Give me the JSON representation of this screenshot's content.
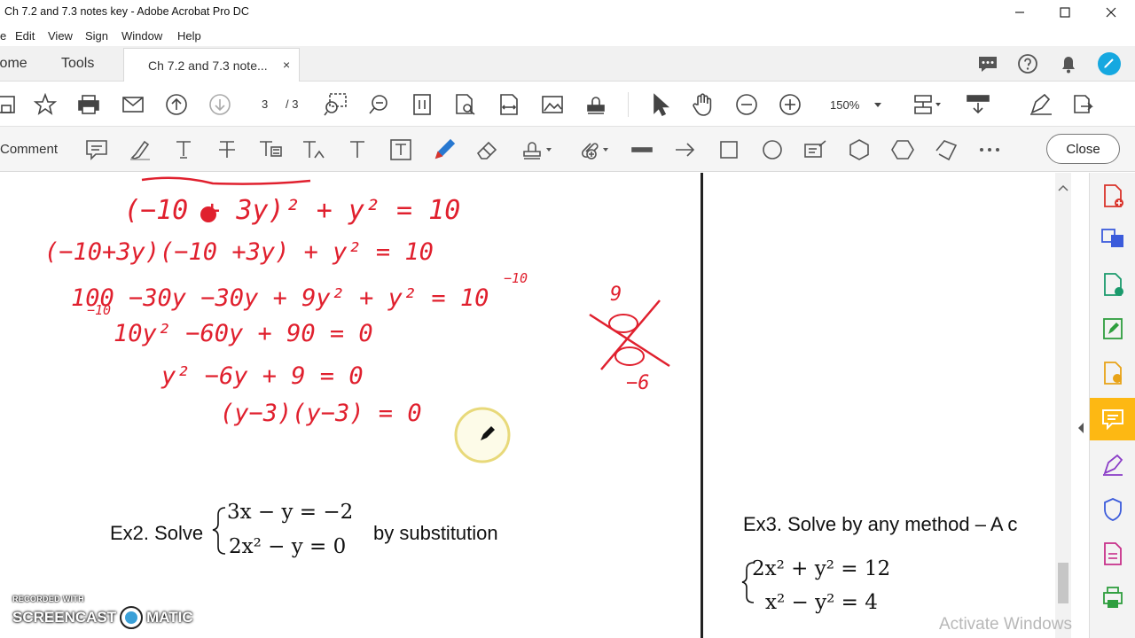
{
  "window": {
    "title": "Ch 7.2 and 7.3 notes key - Adobe Acrobat Pro DC"
  },
  "menu": {
    "items": [
      "e",
      "Edit",
      "View",
      "Sign",
      "Window",
      "Help"
    ]
  },
  "tabs": {
    "home": "Home",
    "tools": "Tools",
    "document": "Ch 7.2 and 7.3 note...",
    "close_glyph": "×"
  },
  "toolbar": {
    "current_page": "3",
    "total_pages": "/ 3",
    "zoom": "150%"
  },
  "comment_toolbar": {
    "label": "Comment",
    "close_label": "Close"
  },
  "document": {
    "handwriting": [
      "(−10 + 3y)² + y² = 10",
      "(−10+3y)(−10 +3y) + y² = 10",
      "100 −30y −30y + 9y² + y² = 10",
      "−10",
      "−10",
      "10y² −60y + 90 = 0",
      "y² −6y + 9 = 0",
      "(y−3)(y−3) = 0",
      "9",
      "−6"
    ],
    "ex2_label": "Ex2. Solve",
    "ex2_eq1": "3x − y = −2",
    "ex2_eq2": "2x² − y = 0",
    "ex2_suffix": "by substitution",
    "ex3_label": "Ex3. Solve by any method – A c",
    "ex3_eq1": "2x² + y² = 12",
    "ex3_eq2": "x² − y² = 4"
  },
  "overlays": {
    "watermark": "Activate Windows",
    "recorded_with": "RECORDED WITH",
    "screencast": "SCREENCAST",
    "matic": "MATIC"
  },
  "colors": {
    "ink": "#e0202e",
    "accent_active": "#fdb813",
    "annot_red": "#d9342b",
    "annot_blue": "#2878d0"
  }
}
